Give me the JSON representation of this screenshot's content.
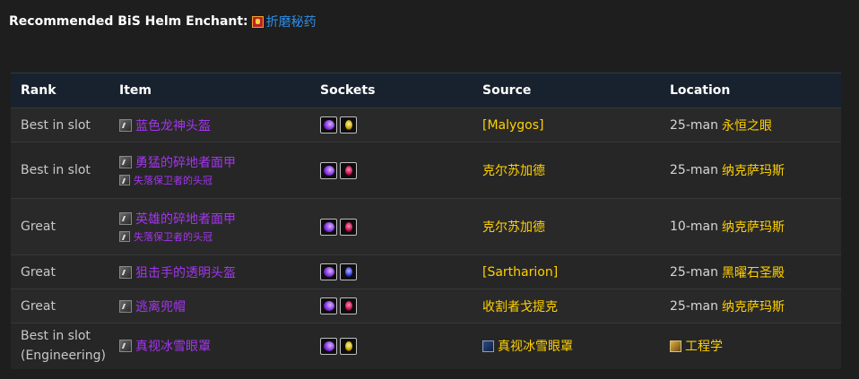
{
  "heading": {
    "label": "Recommended BiS Helm Enchant:",
    "enchant_name": "折磨秘药",
    "enchant_icon": "enchant-scroll-icon"
  },
  "table": {
    "columns": [
      "Rank",
      "Item",
      "Sockets",
      "Source",
      "Location"
    ],
    "rows": [
      {
        "rank": "Best in slot",
        "items": [
          {
            "name": "蓝色龙神头盔",
            "size": "main"
          }
        ],
        "sockets": [
          "meta",
          "yellow"
        ],
        "source": "[Malygos]",
        "loc_prefix": "25-man",
        "loc_zone": "永恒之眼"
      },
      {
        "rank": "Best in slot",
        "items": [
          {
            "name": "勇猛的碎地者面甲",
            "size": "main"
          },
          {
            "name": "失落保卫者的头冠",
            "size": "sub"
          }
        ],
        "sockets": [
          "meta",
          "red"
        ],
        "source": "克尔苏加德",
        "loc_prefix": "25-man",
        "loc_zone": "纳克萨玛斯"
      },
      {
        "rank": "Great",
        "items": [
          {
            "name": "英雄的碎地者面甲",
            "size": "main"
          },
          {
            "name": "失落保卫者的头冠",
            "size": "sub"
          }
        ],
        "sockets": [
          "meta",
          "red"
        ],
        "source": "克尔苏加德",
        "loc_prefix": "10-man",
        "loc_zone": "纳克萨玛斯"
      },
      {
        "rank": "Great",
        "items": [
          {
            "name": "狙击手的透明头盔",
            "size": "main"
          }
        ],
        "sockets": [
          "meta",
          "blue"
        ],
        "source": "[Sartharion]",
        "loc_prefix": "25-man",
        "loc_zone": "黑曜石圣殿"
      },
      {
        "rank": "Great",
        "items": [
          {
            "name": "逃离兜帽",
            "size": "main"
          }
        ],
        "sockets": [
          "meta",
          "red"
        ],
        "source": "收割者戈提克",
        "loc_prefix": "25-man",
        "loc_zone": "纳克萨玛斯"
      },
      {
        "rank": "Best in slot\n(Engineering)",
        "items": [
          {
            "name": "真视冰雪眼罩",
            "size": "main"
          }
        ],
        "sockets": [
          "meta",
          "yellow"
        ],
        "source": "真视冰雪眼罩",
        "source_icon": "goggles-icon",
        "loc_prefix": "",
        "loc_zone": "工程学",
        "loc_icon": "engineering-icon"
      }
    ]
  },
  "colors": {
    "epic_item": "#a335ee",
    "source_gold": "#ffd100",
    "link_blue": "#2e8fe8",
    "header_bg": "#18222e"
  }
}
